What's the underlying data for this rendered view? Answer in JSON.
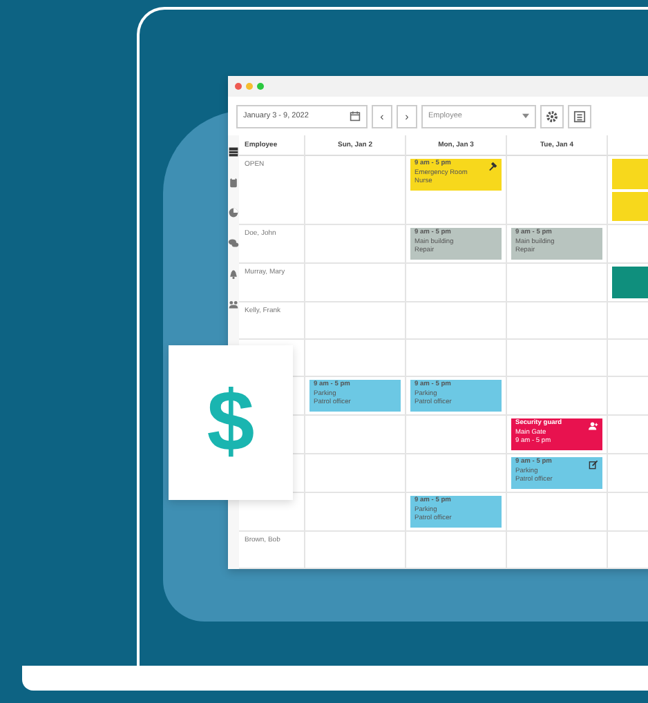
{
  "promo_card": {
    "symbol": "$"
  },
  "window": {
    "controls": [
      {
        "color": "#ee5a52"
      },
      {
        "color": "#f5bd2f"
      },
      {
        "color": "#2bc840"
      }
    ]
  },
  "toolbar": {
    "date_range": "January 3 - 9, 2022",
    "prev": "‹",
    "next": "›",
    "filter": {
      "placeholder": "Employee"
    }
  },
  "sidebar": {
    "items": [
      {
        "kind": "grid",
        "selected": true
      },
      {
        "kind": "clipboard",
        "selected": false
      },
      {
        "kind": "chart",
        "selected": false
      },
      {
        "kind": "chat",
        "selected": false
      },
      {
        "kind": "bell",
        "selected": false
      },
      {
        "kind": "team",
        "selected": false
      }
    ]
  },
  "table": {
    "columns": [
      "Employee",
      "Sun, Jan 2",
      "Mon, Jan 3",
      "Tue, Jan 4"
    ],
    "rows": [
      {
        "employee": "OPEN",
        "cells": [
          [],
          [
            {
              "lines": [
                "9 am - 5 pm",
                "Emergency Room",
                "Nurse"
              ],
              "color": "#f7d81c",
              "kind": "tool"
            }
          ],
          [],
          [
            {
              "color": "#f7d81c",
              "kind": "plain"
            },
            {
              "color": "#f7d81c",
              "kind": "plain"
            }
          ]
        ]
      },
      {
        "employee": "Doe, John",
        "cells": [
          [],
          [
            {
              "lines": [
                "9 am - 5 pm",
                "Main building",
                "Repair"
              ],
              "color": "#b8c4bf",
              "kind": "plain"
            }
          ],
          [
            {
              "lines": [
                "9 am - 5 pm",
                "Main building",
                "Repair"
              ],
              "color": "#b8c4bf",
              "kind": "plain"
            }
          ],
          []
        ]
      },
      {
        "employee": "Murray, Mary",
        "cells": [
          [],
          [],
          [],
          [
            {
              "color": "#0f8f7d",
              "kind": "plain"
            }
          ]
        ]
      },
      {
        "employee": "Kelly, Frank",
        "cells": [
          [],
          [],
          [],
          []
        ]
      },
      {
        "cells": [
          [],
          [],
          [],
          []
        ]
      },
      {
        "cells": [
          [
            {
              "lines": [
                "9 am - 5 pm",
                "Parking",
                "Patrol officer"
              ],
              "color": "#6cc8e4",
              "kind": "plain"
            }
          ],
          [
            {
              "lines": [
                "9 am - 5 pm",
                "Parking",
                "Patrol officer"
              ],
              "color": "#6cc8e4",
              "kind": "plain"
            }
          ],
          [],
          []
        ]
      },
      {
        "cells": [
          [],
          [],
          [
            {
              "lines": [
                "Security guard",
                "Main Gate",
                "9 am - 5 pm"
              ],
              "color": "#e8124f",
              "kind": "person"
            }
          ],
          []
        ]
      },
      {
        "cells": [
          [],
          [],
          [
            {
              "lines": [
                "9 am - 5 pm",
                "Parking",
                "Patrol officer"
              ],
              "color": "#6cc8e4",
              "kind": "edit"
            }
          ],
          []
        ]
      },
      {
        "cells": [
          [],
          [
            {
              "lines": [
                "9 am - 5 pm",
                "Parking",
                "Patrol officer"
              ],
              "color": "#6cc8e4",
              "kind": "plain"
            }
          ],
          [],
          []
        ]
      },
      {
        "employee": "Brown, Bob",
        "cells": [
          [],
          [],
          [],
          []
        ]
      }
    ]
  }
}
